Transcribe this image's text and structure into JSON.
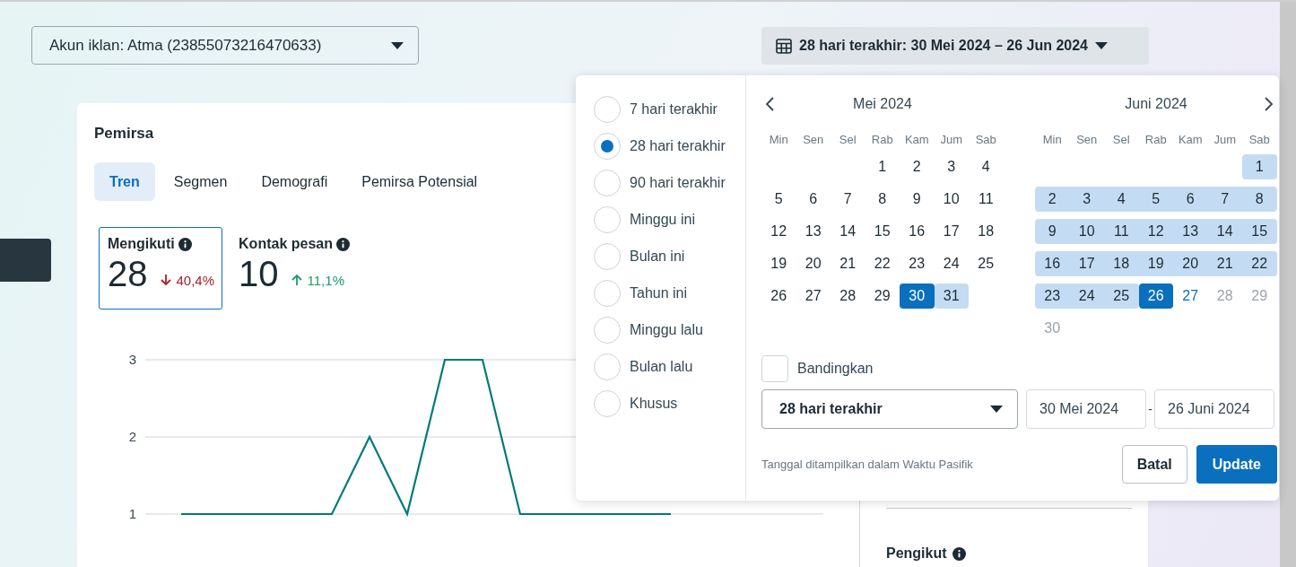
{
  "account_selector": {
    "value": "Akun iklan: Atma (23855073216470633)"
  },
  "date_button": {
    "label": "28 hari terakhir: 30 Mei 2024 – 26 Jun 2024"
  },
  "card": {
    "title": "Pemirsa",
    "tabs": [
      {
        "label": "Tren",
        "selected": true
      },
      {
        "label": "Segmen",
        "selected": false
      },
      {
        "label": "Demografi",
        "selected": false
      },
      {
        "label": "Pemirsa Potensial",
        "selected": false
      }
    ],
    "metrics": [
      {
        "label": "Mengikuti",
        "value": "28",
        "change": "40,4%",
        "rising": false,
        "selected": true
      },
      {
        "label": "Kontak pesan",
        "value": "10",
        "change": "11,1%",
        "rising": true,
        "selected": false
      }
    ],
    "chart_data": {
      "type": "line",
      "yticks": [
        1,
        2,
        3
      ],
      "ylim": [
        1,
        3
      ],
      "series": [
        {
          "color": "#007a7a",
          "values": [
            1,
            1,
            1,
            1,
            1,
            2,
            1,
            3,
            3,
            1,
            1,
            1,
            1,
            1
          ]
        }
      ]
    },
    "side_title": "Pengikut"
  },
  "date_picker": {
    "presets": [
      {
        "label": "7 hari terakhir",
        "selected": false
      },
      {
        "label": "28 hari terakhir",
        "selected": true
      },
      {
        "label": "90 hari terakhir",
        "selected": false
      },
      {
        "label": "Minggu ini",
        "selected": false
      },
      {
        "label": "Bulan ini",
        "selected": false
      },
      {
        "label": "Tahun ini",
        "selected": false
      },
      {
        "label": "Minggu lalu",
        "selected": false
      },
      {
        "label": "Bulan lalu",
        "selected": false
      },
      {
        "label": "Khusus",
        "selected": false
      }
    ],
    "months": [
      {
        "title": "Mei 2024",
        "weekdays": [
          "Min",
          "Sen",
          "Sel",
          "Rab",
          "Kam",
          "Jum",
          "Sab"
        ],
        "weeks": [
          [
            {
              "label": "1",
              "kind": "plain"
            },
            {
              "label": "2",
              "kind": "plain"
            },
            {
              "label": "3",
              "kind": "plain"
            },
            {
              "label": "4",
              "kind": "plain"
            }
          ],
          [
            {
              "label": "5",
              "kind": "plain"
            },
            {
              "label": "6",
              "kind": "plain"
            },
            {
              "label": "7",
              "kind": "plain"
            },
            {
              "label": "8",
              "kind": "plain"
            },
            {
              "label": "9",
              "kind": "plain"
            },
            {
              "label": "10",
              "kind": "plain"
            },
            {
              "label": "11",
              "kind": "plain"
            }
          ],
          [
            {
              "label": "12",
              "kind": "plain"
            },
            {
              "label": "13",
              "kind": "plain"
            },
            {
              "label": "14",
              "kind": "plain"
            },
            {
              "label": "15",
              "kind": "plain"
            },
            {
              "label": "16",
              "kind": "plain"
            },
            {
              "label": "17",
              "kind": "plain"
            },
            {
              "label": "18",
              "kind": "plain"
            }
          ],
          [
            {
              "label": "19",
              "kind": "plain"
            },
            {
              "label": "20",
              "kind": "plain"
            },
            {
              "label": "21",
              "kind": "plain"
            },
            {
              "label": "22",
              "kind": "plain"
            },
            {
              "label": "23",
              "kind": "plain"
            },
            {
              "label": "24",
              "kind": "plain"
            },
            {
              "label": "25",
              "kind": "plain"
            }
          ],
          [
            {
              "label": "26",
              "kind": "plain"
            },
            {
              "label": "27",
              "kind": "plain"
            },
            {
              "label": "28",
              "kind": "plain"
            },
            {
              "label": "29",
              "kind": "plain"
            },
            {
              "label": "30",
              "kind": "endpoint"
            },
            {
              "label": "31",
              "kind": "range"
            }
          ]
        ]
      },
      {
        "title": "Juni 2024",
        "weekdays": [
          "Min",
          "Sen",
          "Sel",
          "Rab",
          "Kam",
          "Jum",
          "Sab"
        ],
        "weeks": [
          [
            {
              "label": "1",
              "kind": "range"
            }
          ],
          [
            {
              "label": "2",
              "kind": "range"
            },
            {
              "label": "3",
              "kind": "range"
            },
            {
              "label": "4",
              "kind": "range"
            },
            {
              "label": "5",
              "kind": "range"
            },
            {
              "label": "6",
              "kind": "range"
            },
            {
              "label": "7",
              "kind": "range"
            },
            {
              "label": "8",
              "kind": "range"
            }
          ],
          [
            {
              "label": "9",
              "kind": "range"
            },
            {
              "label": "10",
              "kind": "range"
            },
            {
              "label": "11",
              "kind": "range"
            },
            {
              "label": "12",
              "kind": "range"
            },
            {
              "label": "13",
              "kind": "range"
            },
            {
              "label": "14",
              "kind": "range"
            },
            {
              "label": "15",
              "kind": "range"
            }
          ],
          [
            {
              "label": "16",
              "kind": "range"
            },
            {
              "label": "17",
              "kind": "range"
            },
            {
              "label": "18",
              "kind": "range"
            },
            {
              "label": "19",
              "kind": "range"
            },
            {
              "label": "20",
              "kind": "range"
            },
            {
              "label": "21",
              "kind": "range"
            },
            {
              "label": "22",
              "kind": "range"
            }
          ],
          [
            {
              "label": "23",
              "kind": "range"
            },
            {
              "label": "24",
              "kind": "range"
            },
            {
              "label": "25",
              "kind": "range"
            },
            {
              "label": "26",
              "kind": "endpoint"
            },
            {
              "label": "27",
              "kind": "today"
            },
            {
              "label": "28",
              "kind": "muted"
            },
            {
              "label": "29",
              "kind": "muted"
            }
          ],
          [
            {
              "label": "30",
              "kind": "muted"
            }
          ]
        ]
      }
    ],
    "compare": {
      "label": "Bandingkan",
      "checked": false
    },
    "range_select": {
      "value": "28 hari terakhir"
    },
    "start_date": {
      "value": "30 Mei 2024"
    },
    "separator": "-",
    "end_date": {
      "value": "26 Juni 2024"
    },
    "note": "Tanggal ditampilkan dalam Waktu Pasifik",
    "buttons": [
      {
        "label": "Batal",
        "kind": "secondary"
      },
      {
        "label": "Update",
        "kind": "primary"
      }
    ]
  }
}
